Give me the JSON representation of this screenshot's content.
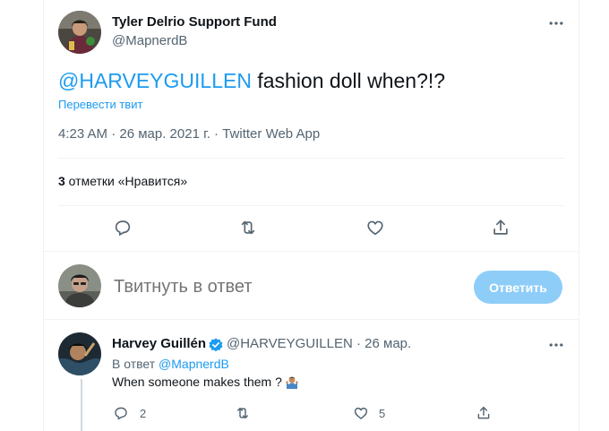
{
  "tweet": {
    "author_name": "Tyler Delrio Support Fund",
    "author_handle": "@MapnerdB",
    "mention": "@HARVEYGUILLEN",
    "text_rest": " fashion doll when?!?",
    "translate": "Перевести твит",
    "meta": "4:23 AM · 26 мар. 2021 г. · Twitter Web App",
    "likes_count": "3",
    "likes_label": " отметки «Нравится»",
    "icons": [
      "reply-icon",
      "retweet-icon",
      "like-icon",
      "share-icon",
      "more-icon"
    ]
  },
  "compose": {
    "placeholder": "Твитнуть в ответ",
    "button": "Ответить"
  },
  "reply": {
    "author_name": "Harvey Guillén",
    "author_handle": "@HARVEYGUILLEN",
    "date": " · 26 мар.",
    "reply_prefix": "В ответ ",
    "reply_mention": "@MapnerdB",
    "text": "When someone makes them ?",
    "reply_count": "2",
    "like_count": "5"
  },
  "colors": {
    "accent": "#1d9bf0",
    "button_disabled": "#8ecdf8",
    "muted": "#536471",
    "text": "#0f1419"
  }
}
